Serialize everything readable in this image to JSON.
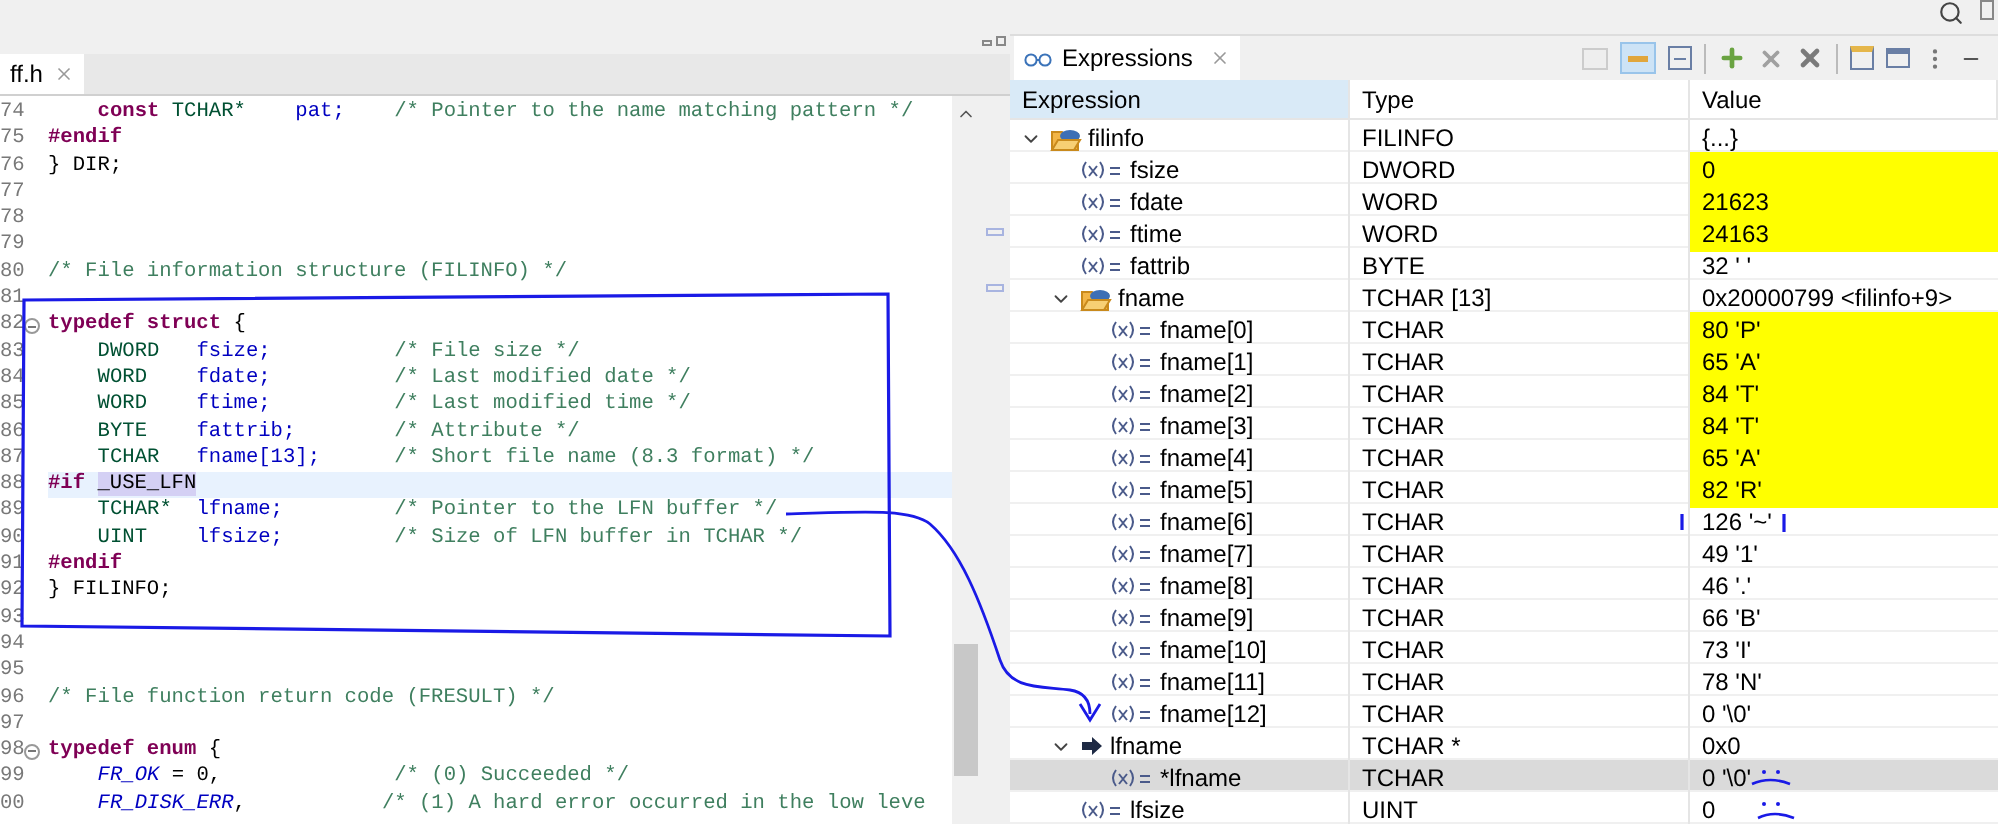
{
  "editor": {
    "tab": {
      "label": "ff.h",
      "selected": true
    },
    "lines": [
      {
        "number": "74",
        "indented": true,
        "tokens": [
          {
            "kind": "keyword",
            "text": "const "
          },
          {
            "kind": "type",
            "text": "TCHAR*    "
          },
          {
            "kind": "ident",
            "text": "pat;    "
          },
          {
            "kind": "comment",
            "text": "/* Pointer to the name matching pattern */"
          }
        ]
      },
      {
        "number": "75",
        "tokens": [
          {
            "kind": "keyword",
            "text": "#endif"
          }
        ]
      },
      {
        "number": "76",
        "tokens": [
          {
            "kind": "plain",
            "text": "} DIR;"
          }
        ]
      },
      {
        "number": "77"
      },
      {
        "number": "78"
      },
      {
        "number": "79"
      },
      {
        "number": "80",
        "tokens": [
          {
            "kind": "comment",
            "text": "/* File information structure (FILINFO) */"
          }
        ]
      },
      {
        "number": "81"
      },
      {
        "number": "82",
        "folding": true,
        "tokens": [
          {
            "kind": "keyword",
            "text": "typedef struct "
          },
          {
            "kind": "plain",
            "text": "{"
          }
        ]
      },
      {
        "number": "83",
        "indented": true,
        "tokens": [
          {
            "kind": "type",
            "text": "DWORD   "
          },
          {
            "kind": "ident",
            "text": "fsize;          "
          },
          {
            "kind": "comment",
            "text": "/* File size */"
          }
        ]
      },
      {
        "number": "84",
        "indented": true,
        "tokens": [
          {
            "kind": "type",
            "text": "WORD    "
          },
          {
            "kind": "ident",
            "text": "fdate;          "
          },
          {
            "kind": "comment",
            "text": "/* Last modified date */"
          }
        ]
      },
      {
        "number": "85",
        "indented": true,
        "tokens": [
          {
            "kind": "type",
            "text": "WORD    "
          },
          {
            "kind": "ident",
            "text": "ftime;          "
          },
          {
            "kind": "comment",
            "text": "/* Last modified time */"
          }
        ]
      },
      {
        "number": "86",
        "indented": true,
        "tokens": [
          {
            "kind": "type",
            "text": "BYTE    "
          },
          {
            "kind": "ident",
            "text": "fattrib;        "
          },
          {
            "kind": "comment",
            "text": "/* Attribute */"
          }
        ]
      },
      {
        "number": "87",
        "indented": true,
        "tokens": [
          {
            "kind": "type",
            "text": "TCHAR   "
          },
          {
            "kind": "ident",
            "text": "fname[13];      "
          },
          {
            "kind": "comment",
            "text": "/* Short file name (8.3 format) */"
          }
        ]
      },
      {
        "number": "88",
        "current": true,
        "tokens": [
          {
            "kind": "keyword",
            "text": "#if "
          },
          {
            "kind": "occurrence",
            "text": "_USE_LFN"
          }
        ]
      },
      {
        "number": "89",
        "indented": true,
        "tokens": [
          {
            "kind": "type",
            "text": "TCHAR*  "
          },
          {
            "kind": "ident",
            "text": "lfname;         "
          },
          {
            "kind": "comment",
            "text": "/* Pointer to the LFN buffer */"
          }
        ]
      },
      {
        "number": "90",
        "indented": true,
        "tokens": [
          {
            "kind": "type",
            "text": "UINT    "
          },
          {
            "kind": "ident",
            "text": "lfsize;         "
          },
          {
            "kind": "comment",
            "text": "/* Size of LFN buffer in TCHAR */"
          }
        ]
      },
      {
        "number": "91",
        "tokens": [
          {
            "kind": "keyword",
            "text": "#endif"
          }
        ]
      },
      {
        "number": "92",
        "tokens": [
          {
            "kind": "plain",
            "text": "} FILINFO;"
          }
        ]
      },
      {
        "number": "93"
      },
      {
        "number": "94"
      },
      {
        "number": "95"
      },
      {
        "number": "96",
        "tokens": [
          {
            "kind": "comment",
            "text": "/* File function return code (FRESULT) */"
          }
        ]
      },
      {
        "number": "97"
      },
      {
        "number": "98",
        "folding": true,
        "tokens": [
          {
            "kind": "keyword",
            "text": "typedef enum "
          },
          {
            "kind": "plain",
            "text": "{"
          }
        ]
      },
      {
        "number": "99",
        "indented": true,
        "tokens": [
          {
            "kind": "enum",
            "text": "FR_OK"
          },
          {
            "kind": "plain",
            "text": " = 0,              "
          },
          {
            "kind": "comment",
            "text": "/* (0) Succeeded */"
          }
        ]
      },
      {
        "number": "00",
        "indented": true,
        "tokens": [
          {
            "kind": "enum",
            "text": "FR_DISK_ERR"
          },
          {
            "kind": "plain",
            "text": ",           "
          },
          {
            "kind": "comment",
            "text": "/* (1) A hard error occurred in the low leve"
          }
        ]
      }
    ]
  },
  "expressions": {
    "tab": {
      "label": "Expressions",
      "selected": true
    },
    "columns": [
      "Expression",
      "Type",
      "Value"
    ],
    "rows": [
      {
        "name": "filinfo",
        "type": "FILINFO",
        "value": "{...}",
        "kind": "struct",
        "expanded": true,
        "changed": false,
        "selected": false,
        "children": [
          {
            "name": "fsize",
            "type": "DWORD",
            "value": "0",
            "kind": "variable",
            "changed": true,
            "selected": false
          },
          {
            "name": "fdate",
            "type": "WORD",
            "value": "21623",
            "kind": "variable",
            "changed": true,
            "selected": false
          },
          {
            "name": "ftime",
            "type": "WORD",
            "value": "24163",
            "kind": "variable",
            "changed": true,
            "selected": false
          },
          {
            "name": "fattrib",
            "type": "BYTE",
            "value": "32 ' '",
            "kind": "variable",
            "changed": false,
            "selected": false
          },
          {
            "name": "fname",
            "type": "TCHAR [13]",
            "value": "0x20000799 <filinfo+9>",
            "kind": "struct",
            "expanded": true,
            "changed": false,
            "selected": false,
            "children": [
              {
                "name": "fname[0]",
                "type": "TCHAR",
                "value": "80 'P'",
                "kind": "variable",
                "changed": true,
                "selected": false
              },
              {
                "name": "fname[1]",
                "type": "TCHAR",
                "value": "65 'A'",
                "kind": "variable",
                "changed": true,
                "selected": false
              },
              {
                "name": "fname[2]",
                "type": "TCHAR",
                "value": "84 'T'",
                "kind": "variable",
                "changed": true,
                "selected": false
              },
              {
                "name": "fname[3]",
                "type": "TCHAR",
                "value": "84 'T'",
                "kind": "variable",
                "changed": true,
                "selected": false
              },
              {
                "name": "fname[4]",
                "type": "TCHAR",
                "value": "65 'A'",
                "kind": "variable",
                "changed": true,
                "selected": false
              },
              {
                "name": "fname[5]",
                "type": "TCHAR",
                "value": "82 'R'",
                "kind": "variable",
                "changed": true,
                "selected": false
              },
              {
                "name": "fname[6]",
                "type": "TCHAR",
                "value": "126 '~'",
                "kind": "variable",
                "changed": false,
                "selected": false
              },
              {
                "name": "fname[7]",
                "type": "TCHAR",
                "value": "49 '1'",
                "kind": "variable",
                "changed": false,
                "selected": false
              },
              {
                "name": "fname[8]",
                "type": "TCHAR",
                "value": "46 '.'",
                "kind": "variable",
                "changed": false,
                "selected": false
              },
              {
                "name": "fname[9]",
                "type": "TCHAR",
                "value": "66 'B'",
                "kind": "variable",
                "changed": false,
                "selected": false
              },
              {
                "name": "fname[10]",
                "type": "TCHAR",
                "value": "73 'I'",
                "kind": "variable",
                "changed": false,
                "selected": false
              },
              {
                "name": "fname[11]",
                "type": "TCHAR",
                "value": "78 'N'",
                "kind": "variable",
                "changed": false,
                "selected": false
              },
              {
                "name": "fname[12]",
                "type": "TCHAR",
                "value": "0 '\\0'",
                "kind": "variable",
                "changed": false,
                "selected": false
              }
            ]
          },
          {
            "name": "lfname",
            "type": "TCHAR *",
            "value": "0x0",
            "kind": "pointer",
            "expanded": true,
            "changed": false,
            "selected": false,
            "children": [
              {
                "name": "*lfname",
                "type": "TCHAR",
                "value": "0 '\\0'",
                "kind": "variable",
                "changed": false,
                "selected": true
              }
            ]
          },
          {
            "name": "lfsize",
            "type": "UINT",
            "value": "0",
            "kind": "variable",
            "changed": false,
            "selected": false
          }
        ]
      }
    ]
  }
}
